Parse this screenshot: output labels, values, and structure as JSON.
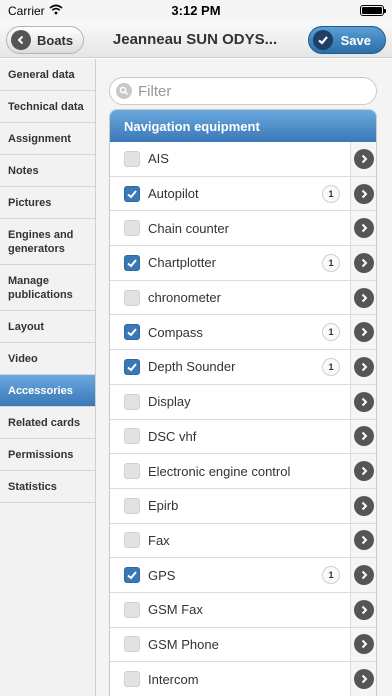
{
  "status_bar": {
    "carrier": "Carrier",
    "time": "3:12 PM"
  },
  "navbar": {
    "back_label": "Boats",
    "title": "Jeanneau SUN ODYS...",
    "save_label": "Save"
  },
  "sidebar": {
    "items": [
      {
        "label": "General data",
        "active": false
      },
      {
        "label": "Technical data",
        "active": false
      },
      {
        "label": "Assignment",
        "active": false
      },
      {
        "label": "Notes",
        "active": false
      },
      {
        "label": "Pictures",
        "active": false
      },
      {
        "label": "Engines and generators",
        "active": false
      },
      {
        "label": "Manage publications",
        "active": false
      },
      {
        "label": "Layout",
        "active": false
      },
      {
        "label": "Video",
        "active": false
      },
      {
        "label": "Accessories",
        "active": true
      },
      {
        "label": "Related cards",
        "active": false
      },
      {
        "label": "Permissions",
        "active": false
      },
      {
        "label": "Statistics",
        "active": false
      }
    ]
  },
  "filter": {
    "placeholder": "Filter"
  },
  "section": {
    "title": "Navigation equipment",
    "items": [
      {
        "label": "AIS",
        "checked": false,
        "count": ""
      },
      {
        "label": "Autopilot",
        "checked": true,
        "count": "1"
      },
      {
        "label": "Chain counter",
        "checked": false,
        "count": ""
      },
      {
        "label": "Chartplotter",
        "checked": true,
        "count": "1"
      },
      {
        "label": "chronometer",
        "checked": false,
        "count": ""
      },
      {
        "label": "Compass",
        "checked": true,
        "count": "1"
      },
      {
        "label": "Depth Sounder",
        "checked": true,
        "count": "1"
      },
      {
        "label": "Display",
        "checked": false,
        "count": ""
      },
      {
        "label": "DSC vhf",
        "checked": false,
        "count": ""
      },
      {
        "label": "Electronic engine control",
        "checked": false,
        "count": ""
      },
      {
        "label": "Epirb",
        "checked": false,
        "count": ""
      },
      {
        "label": "Fax",
        "checked": false,
        "count": ""
      },
      {
        "label": "GPS",
        "checked": true,
        "count": "1"
      },
      {
        "label": "GSM Fax",
        "checked": false,
        "count": ""
      },
      {
        "label": "GSM Phone",
        "checked": false,
        "count": ""
      },
      {
        "label": "Intercom",
        "checked": false,
        "count": ""
      }
    ]
  },
  "colors": {
    "accent": "#3a78b8",
    "header_gradient_top": "#6aa8de"
  }
}
